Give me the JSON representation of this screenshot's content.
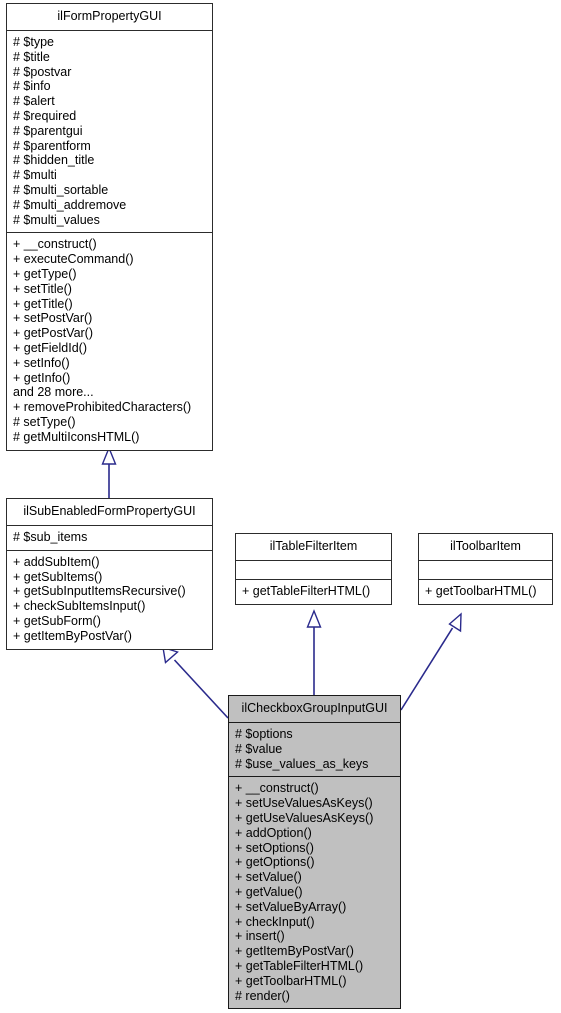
{
  "diagram": {
    "type": "uml-class-diagram",
    "title": "ilCheckboxGroupInputGUI inheritance diagram",
    "colors": {
      "background": "#ffffff",
      "node_fill": "#ffffff",
      "node_border": "#2c2c2c",
      "highlight_fill": "#c0c0c0",
      "edge": "#2a2a8c",
      "text": "#000000"
    },
    "relationship_type": "generalization"
  },
  "nodes": [
    {
      "id": "ilFormPropertyGUI",
      "name": "ilFormPropertyGUI",
      "highlighted": false,
      "attributes": [
        "# $type",
        "# $title",
        "# $postvar",
        "# $info",
        "# $alert",
        "# $required",
        "# $parentgui",
        "# $parentform",
        "# $hidden_title",
        "# $multi",
        "# $multi_sortable",
        "# $multi_addremove",
        "# $multi_values"
      ],
      "methods": [
        "+ __construct()",
        "+ executeCommand()",
        "+ getType()",
        "+ setTitle()",
        "+ getTitle()",
        "+ setPostVar()",
        "+ getPostVar()",
        "+ getFieldId()",
        "+ setInfo()",
        "+ getInfo()",
        "and 28 more...",
        "+ removeProhibitedCharacters()",
        "# setType()",
        "# getMultiIconsHTML()"
      ]
    },
    {
      "id": "ilSubEnabledFormPropertyGUI",
      "name": "ilSubEnabledFormPropertyGUI",
      "highlighted": false,
      "attributes": [
        "# $sub_items"
      ],
      "methods": [
        "+ addSubItem()",
        "+ getSubItems()",
        "+ getSubInputItemsRecursive()",
        "+ checkSubItemsInput()",
        "+ getSubForm()",
        "+ getItemByPostVar()"
      ]
    },
    {
      "id": "ilTableFilterItem",
      "name": "ilTableFilterItem",
      "highlighted": false,
      "attributes": [],
      "methods": [
        "+ getTableFilterHTML()"
      ]
    },
    {
      "id": "ilToolbarItem",
      "name": "ilToolbarItem",
      "highlighted": false,
      "attributes": [],
      "methods": [
        "+ getToolbarHTML()"
      ]
    },
    {
      "id": "ilCheckboxGroupInputGUI",
      "name": "ilCheckboxGroupInputGUI",
      "highlighted": true,
      "attributes": [
        "# $options",
        "# $value",
        "# $use_values_as_keys"
      ],
      "methods": [
        "+ __construct()",
        "+ setUseValuesAsKeys()",
        "+ getUseValuesAsKeys()",
        "+ addOption()",
        "+ setOptions()",
        "+ getOptions()",
        "+ setValue()",
        "+ getValue()",
        "+ setValueByArray()",
        "+ checkInput()",
        "+ insert()",
        "+ getItemByPostVar()",
        "+ getTableFilterHTML()",
        "+ getToolbarHTML()",
        "# render()"
      ]
    }
  ],
  "edges": [
    {
      "from": "ilSubEnabledFormPropertyGUI",
      "to": "ilFormPropertyGUI",
      "kind": "extends"
    },
    {
      "from": "ilCheckboxGroupInputGUI",
      "to": "ilSubEnabledFormPropertyGUI",
      "kind": "extends"
    },
    {
      "from": "ilCheckboxGroupInputGUI",
      "to": "ilTableFilterItem",
      "kind": "implements"
    },
    {
      "from": "ilCheckboxGroupInputGUI",
      "to": "ilToolbarItem",
      "kind": "implements"
    }
  ]
}
